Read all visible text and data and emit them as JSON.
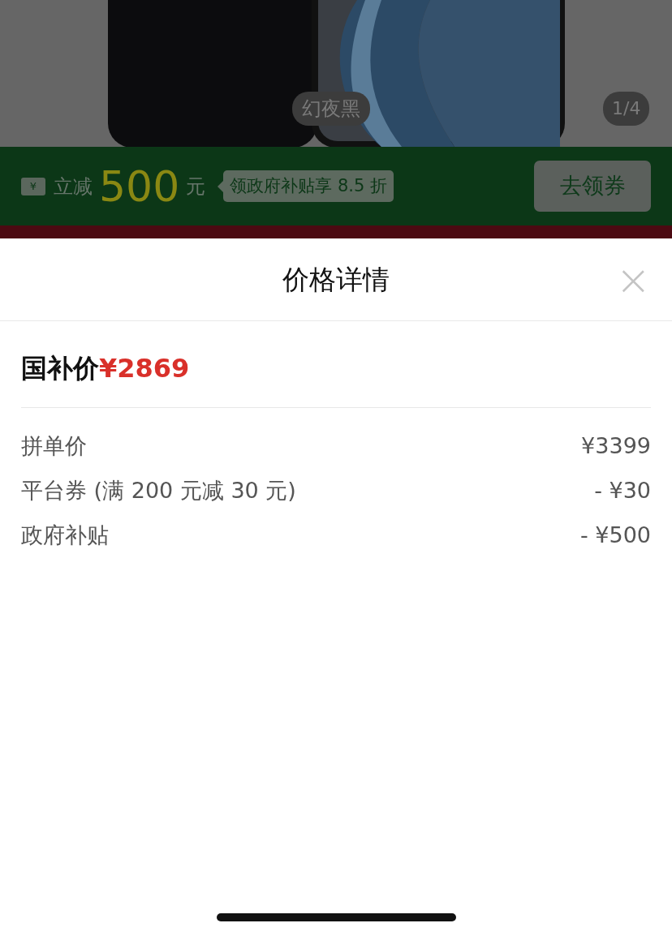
{
  "product_photo": {
    "kind": "picture",
    "color_label": "幻夜黑",
    "page_indicator": "1/4"
  },
  "promo_banner": {
    "ticket_symbol": "¥",
    "prefix": "立减",
    "amount": "500",
    "unit": "元",
    "tag": "领政府补贴享 8.5 折",
    "button": "去领券"
  },
  "sheet": {
    "title": "价格详情",
    "close": "×",
    "final_price": {
      "label": "国补价",
      "value": "¥2869"
    },
    "rows": [
      {
        "label": "拼单价",
        "value": "¥3399"
      },
      {
        "label": "平台券 (满 200 元减 30 元)",
        "value": "- ¥30"
      },
      {
        "label": "政府补贴",
        "value": "- ¥500"
      }
    ]
  }
}
